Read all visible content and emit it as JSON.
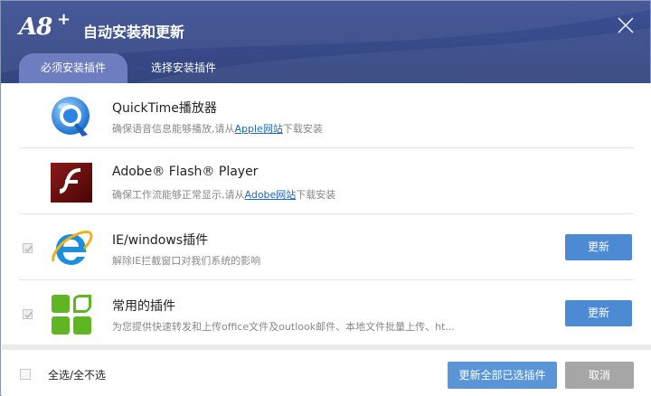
{
  "window": {
    "logo_text": "A8",
    "logo_plus": "+",
    "title": "自动安装和更新"
  },
  "tabs": [
    {
      "label": "必须安装插件",
      "active": true
    },
    {
      "label": "选择安装插件",
      "active": false
    }
  ],
  "plugins": [
    {
      "name": "QuickTime播放器",
      "desc_prefix": "确保语音信息能够播放,请从",
      "link": "Apple网站",
      "desc_suffix": "下载安装",
      "icon": "quicktime-icon"
    },
    {
      "name": "Adobe® Flash® Player",
      "desc_prefix": "确保工作流能够正常显示,请从",
      "link": "Adobe网站",
      "desc_suffix": "下载安装",
      "icon": "flash-icon"
    },
    {
      "name": "IE/windows插件",
      "desc": "解除IE拦截窗口对我们系统的影响",
      "button": "更新",
      "icon": "ie-icon"
    },
    {
      "name": "常用的插件",
      "desc": "为您提供快速转发和上传office文件及outlook邮件、本地文件批量上传、ht...",
      "button": "更新",
      "icon": "plugin-tiles-icon"
    }
  ],
  "footer": {
    "select_all": "全选/全不选",
    "update_selected": "更新全部已选插件",
    "cancel": "取消"
  },
  "colors": {
    "header": "#3b4f93",
    "active_tab": "#6c7dc0",
    "primary": "#4d8ad4",
    "cancel": "#a6a6a6"
  }
}
